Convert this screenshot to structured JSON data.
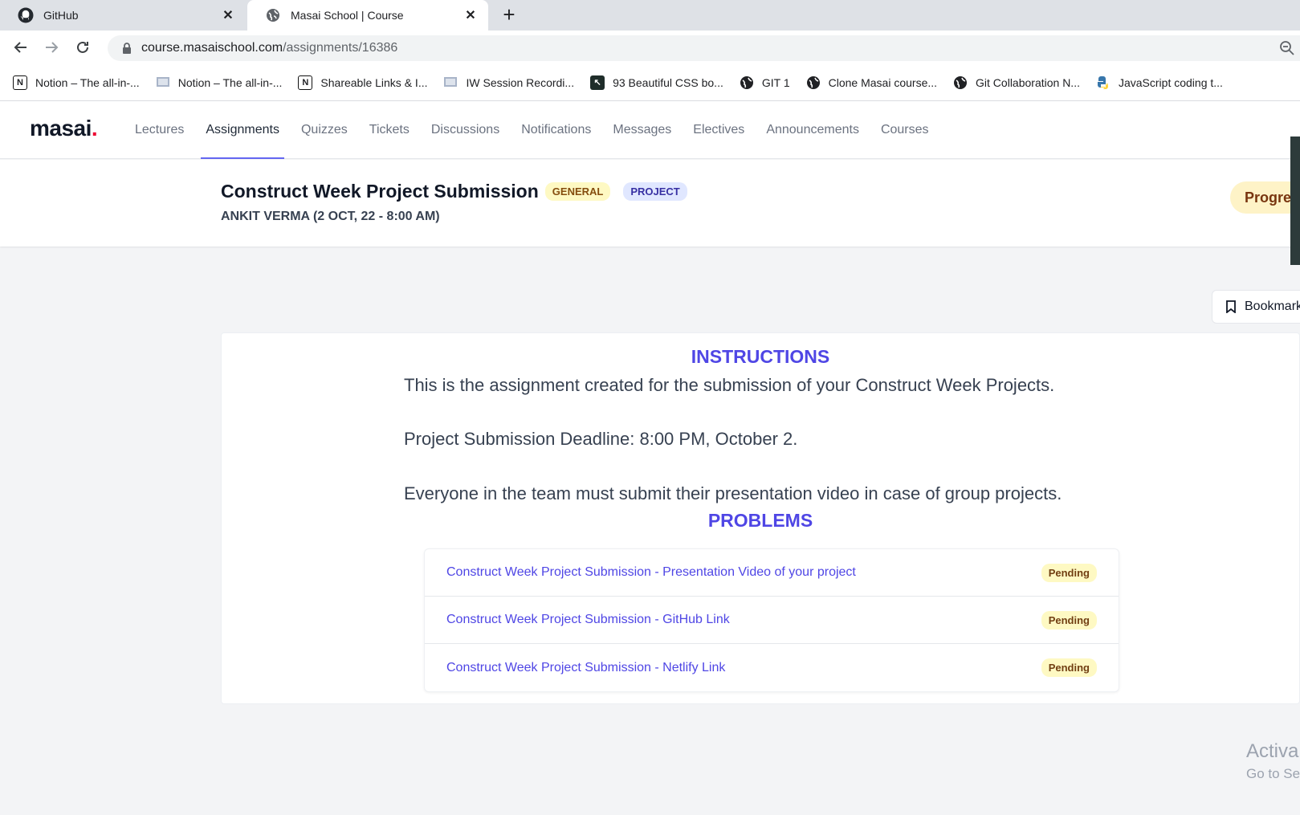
{
  "browser": {
    "tabs": [
      {
        "title": "GitHub",
        "icon": "github-icon",
        "active": false
      },
      {
        "title": "Masai School | Course",
        "icon": "globe-icon",
        "active": true
      }
    ],
    "new_tab_label": "+",
    "url_host": "course.masaischool.com",
    "url_path": "/assignments/16386",
    "bookmarks": [
      {
        "label": "Notion – The all-in-...",
        "icon": "notion-icon"
      },
      {
        "label": "Notion – The all-in-...",
        "icon": "page-icon"
      },
      {
        "label": "Shareable Links & I...",
        "icon": "notion-icon"
      },
      {
        "label": "IW Session Recordi...",
        "icon": "page-icon"
      },
      {
        "label": "93 Beautiful CSS bo...",
        "icon": "cursor-icon"
      },
      {
        "label": "GIT 1",
        "icon": "globe-icon"
      },
      {
        "label": "Clone Masai course...",
        "icon": "globe-icon"
      },
      {
        "label": "Git Collaboration N...",
        "icon": "globe-icon"
      },
      {
        "label": "JavaScript coding t...",
        "icon": "python-icon"
      }
    ]
  },
  "site": {
    "logo": "masai",
    "logo_dot": ".",
    "nav": [
      {
        "label": "Lectures",
        "active": false
      },
      {
        "label": "Assignments",
        "active": true
      },
      {
        "label": "Quizzes",
        "active": false
      },
      {
        "label": "Tickets",
        "active": false
      },
      {
        "label": "Discussions",
        "active": false
      },
      {
        "label": "Notifications",
        "active": false
      },
      {
        "label": "Messages",
        "active": false
      },
      {
        "label": "Electives",
        "active": false
      },
      {
        "label": "Announcements",
        "active": false
      },
      {
        "label": "Courses",
        "active": false
      }
    ]
  },
  "assignment": {
    "title": "Construct Week Project Submission",
    "badges": [
      "GENERAL",
      "PROJECT"
    ],
    "meta": "ANKIT VERMA (2 OCT, 22 - 8:00 AM)",
    "progress_label": "Progre",
    "bookmark_label": "Bookmark"
  },
  "instructions": {
    "heading": "INSTRUCTIONS",
    "lines": [
      "This is the assignment created for the submission of your Construct Week Projects.",
      "Project Submission Deadline: 8:00 PM, October 2.",
      "Everyone in the team must submit their presentation video in case of group projects."
    ]
  },
  "problems": {
    "heading": "PROBLEMS",
    "items": [
      {
        "title": "Construct Week Project Submission - Presentation Video of your project",
        "status": "Pending"
      },
      {
        "title": "Construct Week Project Submission - GitHub Link",
        "status": "Pending"
      },
      {
        "title": "Construct Week Project Submission - Netlify Link",
        "status": "Pending"
      }
    ]
  },
  "watermark": {
    "line1": "Activa",
    "line2": "Go to Se"
  },
  "colors": {
    "accent": "#4f46e5",
    "pending_bg": "#fef9c3",
    "brand_dot": "#ed0331"
  }
}
